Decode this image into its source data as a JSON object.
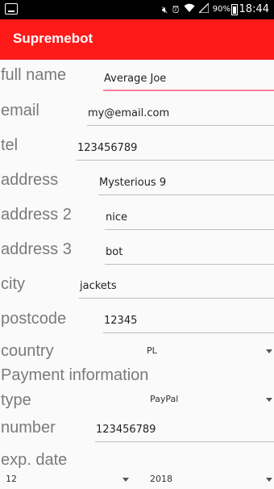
{
  "status_bar": {
    "battery_percent": "90%",
    "time": "18:44"
  },
  "app_bar": {
    "title": "Supremebot"
  },
  "form": {
    "full_name": {
      "label": "full name",
      "value": "Average Joe"
    },
    "email": {
      "label": "email",
      "value": "my@email.com"
    },
    "tel": {
      "label": "tel",
      "value": "123456789"
    },
    "address": {
      "label": "address",
      "value": "Mysterious 9"
    },
    "address2": {
      "label": "address 2",
      "value": "nice"
    },
    "address3": {
      "label": "address 3",
      "value": "bot"
    },
    "city": {
      "label": "city",
      "value": "jackets"
    },
    "postcode": {
      "label": "postcode",
      "value": "12345"
    },
    "country": {
      "label": "country",
      "selected": "PL"
    }
  },
  "payment": {
    "section_title": "Payment information",
    "type": {
      "label": "type",
      "selected": "PayPal"
    },
    "number": {
      "label": "number",
      "value": "123456789"
    },
    "exp_date": {
      "label": "exp. date",
      "month": "12",
      "year": "2018"
    }
  }
}
